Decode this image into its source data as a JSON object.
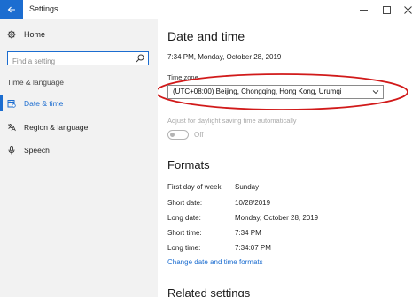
{
  "window": {
    "title": "Settings",
    "accent": "#1c6dd0"
  },
  "sidebar": {
    "home_label": "Home",
    "search_placeholder": "Find a setting",
    "section_label": "Time & language",
    "items": [
      {
        "label": "Date & time",
        "icon": "calendar-icon",
        "active": true
      },
      {
        "label": "Region & language",
        "icon": "region-icon",
        "active": false
      },
      {
        "label": "Speech",
        "icon": "microphone-icon",
        "active": false
      }
    ]
  },
  "main": {
    "heading": "Date and time",
    "current_datetime": "7:34 PM, Monday, October 28, 2019",
    "time_zone": {
      "label": "Time zone",
      "selected": "(UTC+08:00) Beijing, Chongqing, Hong Kong, Urumqi"
    },
    "dst": {
      "label": "Adjust for daylight saving time automatically",
      "state": "Off"
    },
    "formats": {
      "heading": "Formats",
      "rows": [
        {
          "key": "First day of week:",
          "value": "Sunday"
        },
        {
          "key": "Short date:",
          "value": "10/28/2019"
        },
        {
          "key": "Long date:",
          "value": "Monday, October 28, 2019"
        },
        {
          "key": "Short time:",
          "value": "7:34 PM"
        },
        {
          "key": "Long time:",
          "value": "7:34:07 PM"
        }
      ],
      "change_link": "Change date and time formats"
    },
    "related_heading": "Related settings"
  },
  "annotation": {
    "ellipse_color": "#d11a1a"
  }
}
